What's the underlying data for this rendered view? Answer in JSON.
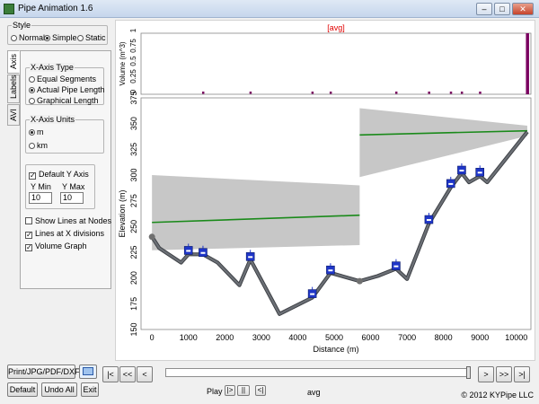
{
  "window": {
    "title": "Pipe Animation 1.6",
    "min": "–",
    "max": "□",
    "close": "✕"
  },
  "style_group": {
    "label": "Style",
    "options": [
      "Normal",
      "Simple",
      "Static"
    ],
    "selected": "Simple"
  },
  "tabs": [
    "Axis",
    "Labels",
    "AVI"
  ],
  "xaxis_type": {
    "label": "X-Axis Type",
    "options": [
      "Equal Segments",
      "Actual Pipe Length",
      "Graphical Length"
    ],
    "selected": "Actual Pipe Length"
  },
  "xaxis_units": {
    "label": "X-Axis Units",
    "options": [
      "m",
      "km"
    ],
    "selected": "m"
  },
  "yaxis": {
    "default_label": "Default Y Axis",
    "ymin_label": "Y Min",
    "ymax_label": "Y Max",
    "ymin": "10",
    "ymax": "10"
  },
  "options": {
    "show_lines": "Show Lines at Nodes",
    "lines_x": "Lines at X divisions",
    "volume_graph": "Volume Graph"
  },
  "buttons": {
    "print": "Print/JPG/PDF/DXF",
    "default": "Default",
    "undo": "Undo All",
    "exit": "Exit",
    "first": "|<",
    "prev_fast": "<<",
    "prev": "<",
    "next": ">",
    "next_fast": ">>",
    "last": ">|",
    "play": "Play",
    "play_icon": "|>",
    "pause": "||",
    "back": "<|"
  },
  "status": {
    "avg": "avg",
    "copyright": "© 2012 KYPipe LLC"
  },
  "chart_data": [
    {
      "type": "bar",
      "title": "[avg]",
      "ylabel": "Volume (m^3)",
      "yticks": [
        "1",
        "0.75",
        "0.5",
        "0.25",
        "0"
      ],
      "ylim": [
        0,
        1
      ],
      "xlim": [
        -300,
        10400
      ],
      "markers_x": [
        1400,
        2700,
        4400,
        4900,
        6700,
        7600,
        8200,
        8500,
        9000
      ],
      "bars": [
        {
          "x": 10300,
          "value": 1
        }
      ],
      "bar_color": "#7a0060"
    },
    {
      "type": "line",
      "xlabel": "Distance (m)",
      "ylabel": "Elevation (m)",
      "xticks": [
        "0",
        "1000",
        "2000",
        "3000",
        "4000",
        "5000",
        "6000",
        "7000",
        "8000",
        "9000",
        "10000"
      ],
      "yticks": [
        "150",
        "175",
        "200",
        "225",
        "250",
        "275",
        "300",
        "325",
        "350",
        "375"
      ],
      "xlim": [
        -300,
        10400
      ],
      "ylim": [
        150,
        375
      ],
      "pipe_profile": {
        "x": [
          0,
          200,
          800,
          1000,
          1400,
          1800,
          2400,
          2700,
          3500,
          4400,
          4900,
          5700,
          6200,
          6700,
          7000,
          7600,
          8200,
          8500,
          8700,
          9000,
          9200,
          10300
        ],
        "y": [
          240,
          229,
          215,
          223,
          223,
          215,
          193,
          218,
          165,
          181,
          205,
          197,
          202,
          209,
          199,
          253,
          288,
          302,
          293,
          299,
          293,
          342
        ]
      },
      "hgl_series": [
        {
          "x": [
            0,
            5700
          ],
          "y": [
            254,
            261
          ]
        },
        {
          "x": [
            5700,
            10300
          ],
          "y": [
            339,
            343
          ]
        }
      ],
      "envelope_bands": [
        {
          "x": [
            0,
            5700
          ],
          "ymin": [
            227,
            232
          ],
          "ymax": [
            300,
            290
          ]
        },
        {
          "x": [
            5700,
            10300
          ],
          "ymin": [
            298,
            338
          ],
          "ymax": [
            365,
            348
          ]
        }
      ],
      "node_markers": [
        {
          "x": 1000,
          "y": 222
        },
        {
          "x": 1400,
          "y": 220
        },
        {
          "x": 2700,
          "y": 216
        },
        {
          "x": 4400,
          "y": 180
        },
        {
          "x": 4900,
          "y": 203
        },
        {
          "x": 6700,
          "y": 207
        },
        {
          "x": 7600,
          "y": 252
        },
        {
          "x": 8200,
          "y": 287
        },
        {
          "x": 8500,
          "y": 300
        },
        {
          "x": 9000,
          "y": 298
        }
      ],
      "dots": [
        {
          "x": 0,
          "y": 240
        },
        {
          "x": 5700,
          "y": 197
        }
      ],
      "colors": {
        "pipe": "#6b6f75",
        "hgl": "#1a8a1a",
        "band": "#c7c7c7",
        "marker": "#1f36c8"
      }
    }
  ]
}
